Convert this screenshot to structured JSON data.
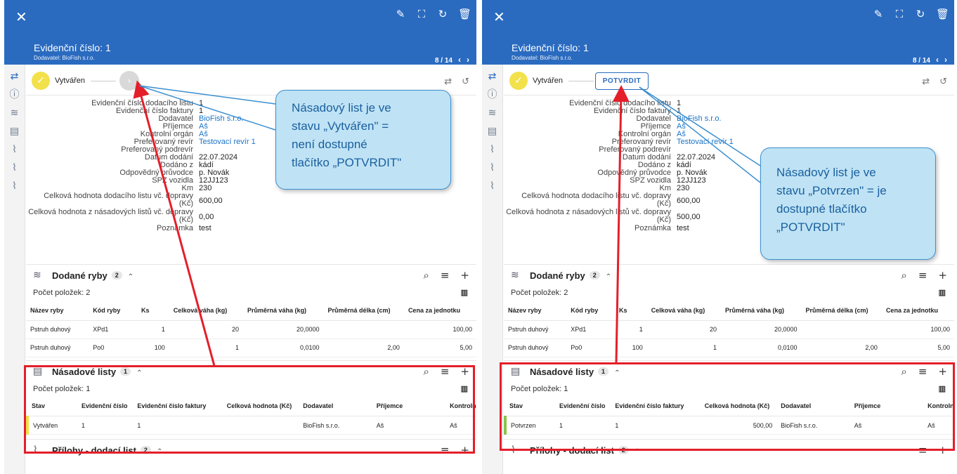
{
  "left": {
    "header": {
      "title": "Evidenční číslo: 1",
      "subtitle": "Dodavatel: BioFish s.r.o.",
      "pager": "8 / 14"
    },
    "status": {
      "label": "Vytvářen",
      "next_glyph": "›"
    },
    "callout": [
      "Násadový list je ve",
      "stavu „Vytvářen\" =",
      "není dostupné",
      "tlačítko „POTVRDIT\""
    ],
    "details": [
      {
        "k": "Evidenční číslo dodacího listu",
        "v": "1"
      },
      {
        "k": "Evidenční číslo faktury",
        "v": "1"
      },
      {
        "k": "Dodavatel",
        "v": "BioFish s.r.o."
      },
      {
        "k": "Příjemce",
        "v": "Aš"
      },
      {
        "k": "Kontrolní orgán",
        "v": "Aš"
      },
      {
        "k": "Preferovaný revír",
        "v": "Testovací revír 1"
      },
      {
        "k": "Preferovaný podrevír",
        "v": ""
      },
      {
        "k": "Datum dodání",
        "v": "22.07.2024"
      },
      {
        "k": "Dodáno z",
        "v": "kádí"
      },
      {
        "k": "Odpovědný průvodce",
        "v": "p. Novák"
      },
      {
        "k": "SPZ vozidla",
        "v": "12JJ123"
      },
      {
        "k": "Km",
        "v": "230"
      },
      {
        "k1": "Celková hodnota dodacího listu vč. dopravy",
        "k2": "(Kč)",
        "v": "600,00"
      },
      {
        "k1": "Celková hodnota z násadových listů vč. dopravy",
        "k2": "(Kč)",
        "v": "0,00"
      },
      {
        "k": "Poznámka",
        "v": "test"
      }
    ],
    "fish_section": {
      "name": "Dodané ryby",
      "count": "2",
      "items_label": "Počet položek: 2"
    },
    "fish_headers": [
      "Název ryby",
      "Kód ryby",
      "Ks",
      "Celková váha (kg)",
      "Průměrná váha (kg)",
      "Průměrná délka (cm)",
      "Cena za jednotku"
    ],
    "fish_rows": [
      [
        "Pstruh duhový",
        "XPd1",
        "1",
        "20",
        "20,0000",
        "",
        "100,00"
      ],
      [
        "Pstruh duhový",
        "Po0",
        "100",
        "1",
        "0,0100",
        "2,00",
        "5,00"
      ]
    ],
    "nasad_section": {
      "name": "Násadové listy",
      "count": "1",
      "items_label": "Počet položek: 1"
    },
    "nasad_headers": [
      "Stav",
      "Evidenční číslo",
      "Evidenční číslo faktury",
      "Celková hodnota (Kč)",
      "Dodavatel",
      "Příjemce",
      "Kontrolní"
    ],
    "nasad_row": [
      "Vytvářen",
      "1",
      "1",
      "",
      "BioFish s.r.o.",
      "Aš",
      "Aš"
    ],
    "attach_section": {
      "name": "Přílohy - dodací list",
      "count": "2"
    }
  },
  "right": {
    "header": {
      "title": "Evidenční číslo: 1",
      "subtitle": "Dodavatel: BioFish s.r.o.",
      "pager": "8 / 14"
    },
    "status": {
      "label": "Vytvářen",
      "button": "POTVRDIT"
    },
    "callout": [
      "Násadový list je ve",
      "stavu „Potvrzen\" = je",
      "dostupné tlačítko",
      "„POTVRDIT\""
    ],
    "details": [
      {
        "k": "Evidenční číslo dodacího listu",
        "v": "1"
      },
      {
        "k": "Evidenční číslo faktury",
        "v": "1"
      },
      {
        "k": "Dodavatel",
        "v": "BioFish s.r.o."
      },
      {
        "k": "Příjemce",
        "v": "Aš"
      },
      {
        "k": "Kontrolní orgán",
        "v": "Aš"
      },
      {
        "k": "Preferovaný revír",
        "v": "Testovací revír 1"
      },
      {
        "k": "Preferovaný podrevír",
        "v": ""
      },
      {
        "k": "Datum dodání",
        "v": "22.07.2024"
      },
      {
        "k": "Dodáno z",
        "v": "kádí"
      },
      {
        "k": "Odpovědný průvodce",
        "v": "p. Novák"
      },
      {
        "k": "SPZ vozidla",
        "v": "12JJ123"
      },
      {
        "k": "Km",
        "v": "230"
      },
      {
        "k1": "Celková hodnota dodacího listu vč. dopravy",
        "k2": "(Kč)",
        "v": "600,00"
      },
      {
        "k1": "Celková hodnota z násadových listů vč. dopravy",
        "k2": "(Kč)",
        "v": "500,00"
      },
      {
        "k": "Poznámka",
        "v": "test"
      }
    ],
    "fish_section": {
      "name": "Dodané ryby",
      "count": "2",
      "items_label": "Počet položek: 2"
    },
    "fish_headers": [
      "Název ryby",
      "Kód ryby",
      "Ks",
      "Celková váha (kg)",
      "Průměrná váha (kg)",
      "Průměrná délka (cm)",
      "Cena za jednotku"
    ],
    "fish_rows": [
      [
        "Pstruh duhový",
        "XPd1",
        "1",
        "20",
        "20,0000",
        "",
        "100,00"
      ],
      [
        "Pstruh duhový",
        "Po0",
        "100",
        "1",
        "0,0100",
        "2,00",
        "5,00"
      ]
    ],
    "nasad_section": {
      "name": "Násadové listy",
      "count": "1",
      "items_label": "Počet položek: 1"
    },
    "nasad_headers": [
      "Stav",
      "Evidenční číslo",
      "Evidenční číslo faktury",
      "Celková hodnota (Kč)",
      "Dodavatel",
      "Příjemce",
      "Kontroln"
    ],
    "nasad_row": [
      "Potvrzen",
      "1",
      "1",
      "500,00",
      "BioFish s.r.o.",
      "Aš",
      "Aš"
    ],
    "attach_section": {
      "name": "Přílohy - dodací list",
      "count": "2"
    }
  },
  "colors": {
    "header": "#2a6bc0",
    "annotation_red": "#e41f2a",
    "callout_bg": "#bfe3f5"
  },
  "icons": {
    "close": "close-icon",
    "edit": "pencil-icon",
    "fullscreen": "fullscreen-icon",
    "refresh": "refresh-icon",
    "delete": "trash-icon"
  }
}
